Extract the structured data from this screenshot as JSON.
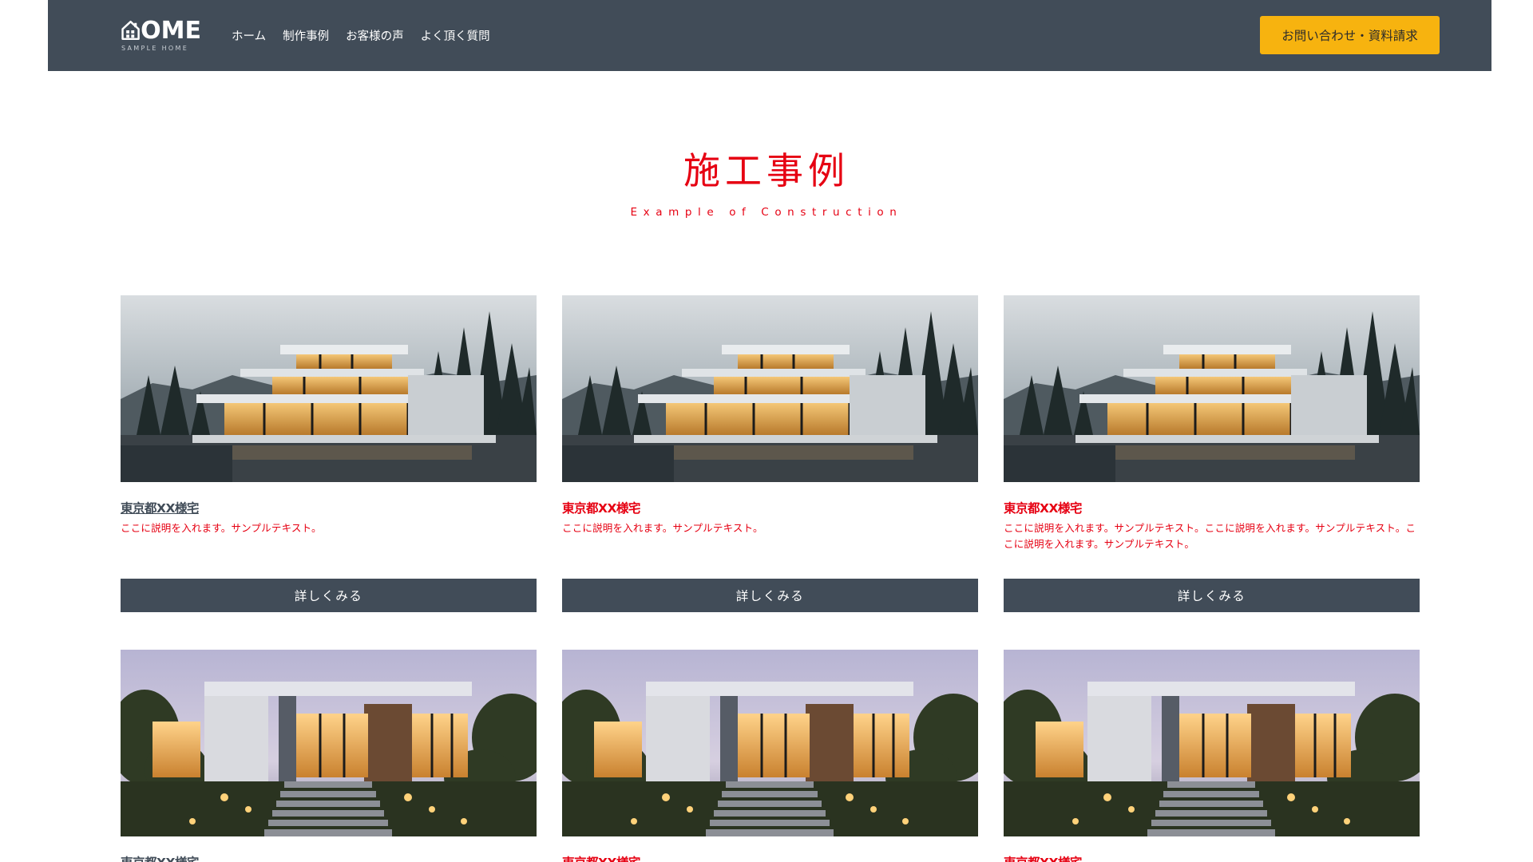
{
  "header": {
    "logo_text": "OME",
    "logo_subtext": "SAMPLE HOME",
    "nav": [
      "ホーム",
      "制作事例",
      "お客様の声",
      "よく頂く質問"
    ],
    "contact_button": "お問い合わせ・資料請求"
  },
  "section": {
    "title": "施工事例",
    "subtitle": "Example of Construction"
  },
  "cards": [
    {
      "title": "東京都XX様宅",
      "description": "ここに説明を入れます。サンプルテキスト。",
      "button": "詳しくみる"
    },
    {
      "title": "東京都XX様宅",
      "description": "ここに説明を入れます。サンプルテキスト。",
      "button": "詳しくみる"
    },
    {
      "title": "東京都XX様宅",
      "description": "ここに説明を入れます。サンプルテキスト。ここに説明を入れます。サンプルテキスト。ここに説明を入れます。サンプルテキスト。",
      "button": "詳しくみる"
    },
    {
      "title": "東京都XX様宅"
    },
    {
      "title": "東京都XX様宅"
    },
    {
      "title": "東京都XX様宅"
    }
  ],
  "colors": {
    "header_bg": "#414c58",
    "accent_yellow": "#f7b30f",
    "accent_red": "#e60012",
    "button_bg": "#414c58"
  },
  "icons": {
    "logo": "house-icon"
  }
}
